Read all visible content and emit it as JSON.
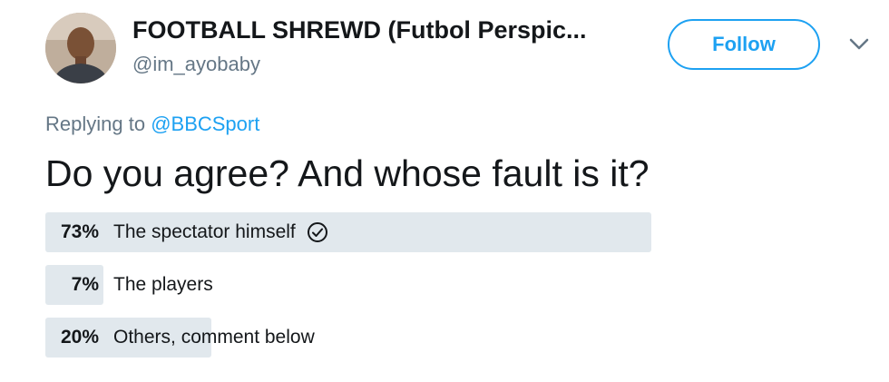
{
  "author": {
    "display_name": "FOOTBALL SHREWD (Futbol Perspic...",
    "handle": "@im_ayobaby",
    "avatar_icon": "profile-photo"
  },
  "follow_label": "Follow",
  "caret_icon": "chevron-down-icon",
  "reply": {
    "prefix": "Replying to ",
    "mention": "@BBCSport"
  },
  "tweet_text": "Do you agree? And whose fault is it?",
  "poll": {
    "options": [
      {
        "percent_label": "73%",
        "label": "The spectator himself",
        "share": 0.73,
        "winner": true
      },
      {
        "percent_label": "7%",
        "label": "The players",
        "share": 0.07,
        "winner": false
      },
      {
        "percent_label": "20%",
        "label": "Others, comment below",
        "share": 0.2,
        "winner": false
      }
    ]
  },
  "colors": {
    "accent": "#1da1f2",
    "poll_bar": "#e1e8ed",
    "secondary_text": "#657786"
  }
}
